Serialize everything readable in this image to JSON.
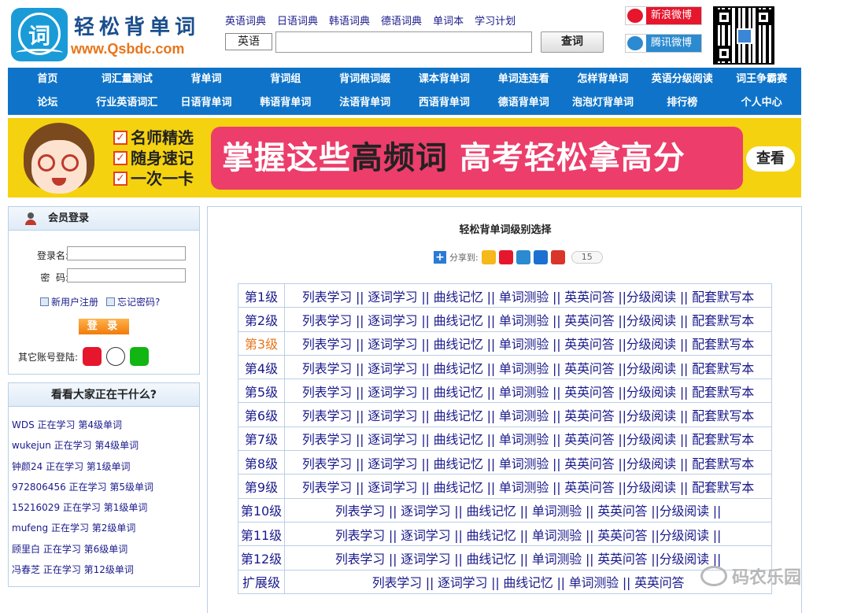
{
  "header": {
    "logo_char": "词",
    "logo_title": "轻松背单词",
    "logo_url": "www.Qsbdc.com",
    "dict_links": [
      "英语词典",
      "日语词典",
      "韩语词典",
      "德语词典",
      "单词本",
      "学习计划"
    ],
    "lang_select": "英语",
    "search_button": "查词",
    "social": [
      "新浪微博",
      "腾讯微博"
    ]
  },
  "nav": {
    "row1": [
      "首页",
      "词汇量测试",
      "背单词",
      "背词组",
      "背词根词缀",
      "课本背单词",
      "单词连连看",
      "怎样背单词",
      "英语分级阅读",
      "词王争霸赛"
    ],
    "row2": [
      "论坛",
      "行业英语词汇",
      "日语背单词",
      "韩语背单词",
      "法语背单词",
      "西语背单词",
      "德语背单词",
      "泡泡灯背单词",
      "排行榜",
      "个人中心"
    ]
  },
  "banner": {
    "checks": [
      "名师精选",
      "随身速记",
      "一次一卡"
    ],
    "slogan_a": "掌握这些",
    "slogan_b": "高频词",
    "slogan_c": "高考轻松拿高分",
    "view_button": "查看"
  },
  "login": {
    "title": "会员登录",
    "username_label": "登录名:",
    "password_label": "密  码:",
    "register": "新用户注册",
    "forgot": "忘记密码?",
    "login_button": "登 录",
    "other_label": "其它账号登陆:"
  },
  "activity": {
    "title": "看看大家正在干什么?",
    "items": [
      "WDS 正在学习 第4级单词",
      "wukejun 正在学习 第4级单词",
      "钟颜24 正在学习 第1级单词",
      "972806456 正在学习 第5级单词",
      "15216029 正在学习 第1级单词",
      "mufeng 正在学习 第2级单词",
      "顾里白 正在学习 第6级单词",
      "冯春芝 正在学习 第12级单词"
    ]
  },
  "main": {
    "title": "轻松背单词级别选择",
    "share_label": "分享到:",
    "share_count": "15",
    "full_actions": "列表学习 || 逐词学习 || 曲线记忆 || 单词测验 || 英英问答 ||分级阅读 || 配套默写本",
    "mid_actions": "列表学习 || 逐词学习 || 曲线记忆 || 单词测验 || 英英问答 ||分级阅读 ||",
    "ext_actions": "列表学习 || 逐词学习 || 曲线记忆 || 单词测验 || 英英问答",
    "levels": [
      "第1级",
      "第2级",
      "第3级",
      "第4级",
      "第5级",
      "第6级",
      "第7级",
      "第8级",
      "第9级",
      "第10级",
      "第11级",
      "第12级",
      "扩展级"
    ]
  },
  "watermark": "码农乐园",
  "colors": {
    "nav_bg": "#0f74c9",
    "banner_bg": "#f5d20f",
    "pill": "#ec3d6b",
    "link": "#1a1a8c",
    "current_level": "#e8751a"
  }
}
